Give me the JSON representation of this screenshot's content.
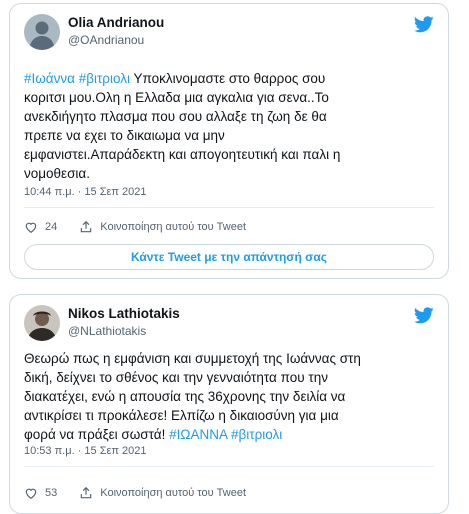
{
  "tweet1": {
    "name": "Olia Andrianou",
    "handle": "@OAndrianou",
    "hashtags": [
      "#Ιωάννα",
      "#βιτριολι"
    ],
    "text_lines": [
      "Υποκλινομαστε στο θαρρος σου",
      "κοριτσι μου.Ολη η Ελλαδα μια αγκαλια για σενα..Το",
      "ανεκδιήγητο πλασμα που σου αλλαξε τη ζωη δε θα",
      "πρεπε να εχει το δικαιωμα να μην",
      "εμφανιστει.Απαράδεκτη και απογοητευτική και παλι η",
      "νομοθεσια."
    ],
    "timestamp": "10:44 π.μ. · 15 Σεπ 2021",
    "likes": "24",
    "share_label": "Κοινοποίηση αυτού του Tweet",
    "reply_button": "Κάντε Tweet με την απάντησή σας",
    "icons": {
      "avatar": "default-avatar-icon",
      "brand": "twitter-bird-icon",
      "like": "heart-icon",
      "share": "share-icon"
    }
  },
  "tweet2": {
    "name": "Nikos Lathiotakis",
    "handle": "@NLathiotakis",
    "text_lines": [
      "Θεωρώ πως η εμφάνιση και συμμετοχή της Ιωάννας στη",
      "δική, δείχνει το σθένος και την γενναιότητα που την",
      "διακατέχει, ενώ η απουσία της 36χρονης την δειλία να",
      "αντικρίσει τι προκάλεσε! Ελπίζω η δικαιοσύνη για μια",
      "φορά να πράξει σωστά!"
    ],
    "hashtags": [
      "#ΙΩΑΝΝΑ",
      "#βιτριολι"
    ],
    "timestamp": "10:53 π.μ. · 15 Σεπ 2021",
    "likes": "53",
    "share_label": "Κοινοποίηση αυτού του Tweet",
    "icons": {
      "avatar": "profile-photo-icon",
      "brand": "twitter-bird-icon",
      "like": "heart-icon",
      "share": "share-icon"
    }
  },
  "colors": {
    "accent": "#1d9bf0",
    "text": "#0f1419",
    "secondary": "#536471",
    "border": "#cfd9de"
  }
}
